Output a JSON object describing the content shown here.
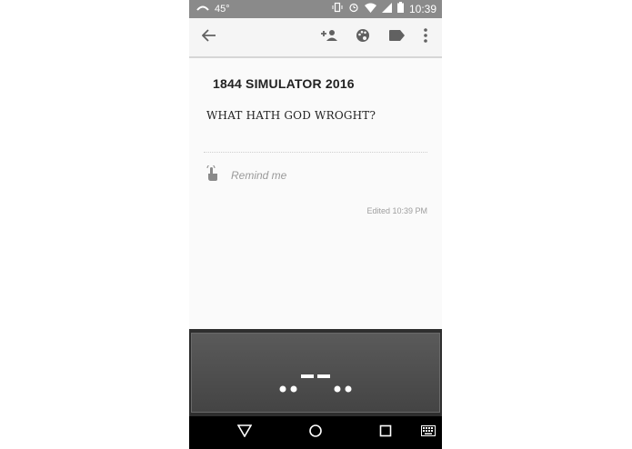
{
  "status_bar": {
    "temperature": "45°",
    "time": "10:39"
  },
  "note": {
    "title": "1844 SIMULATOR 2016",
    "body": "WHAT HATH GOD WROGHT?",
    "reminder_label": "Remind me",
    "edited": "Edited 10:39 PM"
  },
  "keyboard": {
    "morse_pattern": "..--.."
  },
  "icons": {
    "toolbar": [
      "back-arrow-icon",
      "add-collaborator-icon",
      "palette-icon",
      "label-icon",
      "more-vert-icon"
    ],
    "navigation": [
      "back-triangle-icon",
      "home-circle-icon",
      "recents-square-icon",
      "keyboard-icon"
    ]
  },
  "colors": {
    "status_bar": "#8a8a8a",
    "note_background": "#fafafa",
    "keyboard_key": "#4a4a4a",
    "nav_bar": "#000000"
  }
}
